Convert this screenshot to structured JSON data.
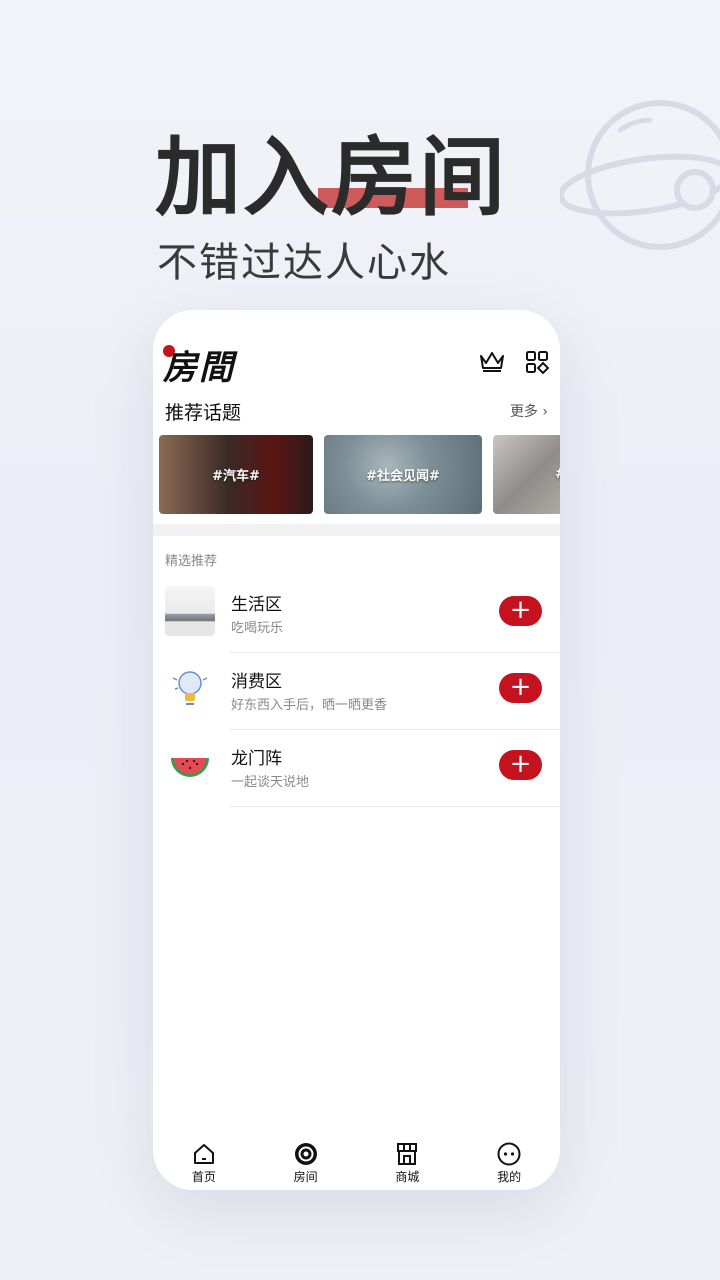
{
  "hero": {
    "title": "加入房间",
    "subtitle": "不错过达人心水"
  },
  "app": {
    "logo": "房間",
    "icons": [
      "crown-icon",
      "grid-icon"
    ]
  },
  "topics": {
    "title": "推荐话题",
    "more": "更多",
    "items": [
      {
        "label": "#汽车#"
      },
      {
        "label": "#社会见闻#"
      },
      {
        "label": "#"
      }
    ]
  },
  "featured": {
    "label": "精选推荐",
    "rows": [
      {
        "name": "生活区",
        "desc": "吃喝玩乐",
        "icon": "sofa-image"
      },
      {
        "name": "消费区",
        "desc": "好东西入手后，晒一晒更香",
        "icon": "lightbulb-icon"
      },
      {
        "name": "龙门阵",
        "desc": "一起谈天说地",
        "icon": "watermelon-icon"
      }
    ],
    "add_label": "+"
  },
  "tabbar": {
    "items": [
      {
        "label": "首页",
        "icon": "home-icon"
      },
      {
        "label": "房间",
        "icon": "room-icon"
      },
      {
        "label": "商城",
        "icon": "shop-icon"
      },
      {
        "label": "我的",
        "icon": "profile-icon"
      }
    ]
  },
  "colors": {
    "accent": "#c5121f",
    "hero_underline": "#c94a4a",
    "background": "#eef0f7"
  }
}
